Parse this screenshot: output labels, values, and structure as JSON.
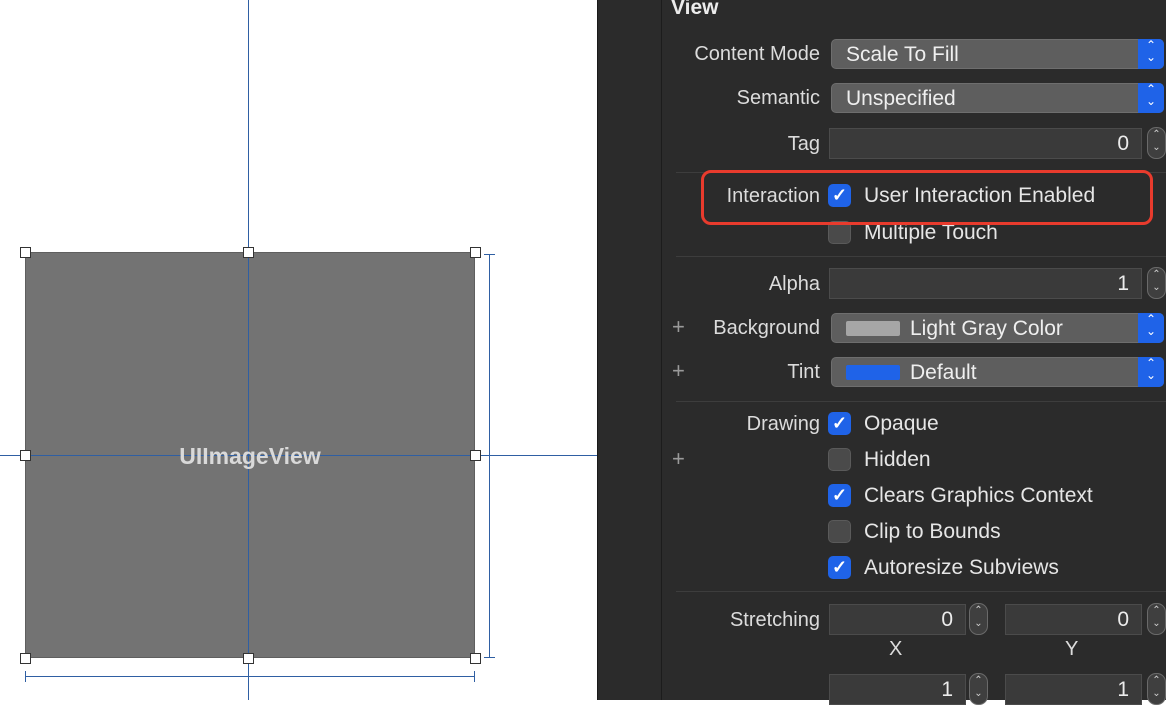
{
  "canvas": {
    "view_label": "UIImageView"
  },
  "inspector": {
    "section_title": "View",
    "content_mode": {
      "label": "Content Mode",
      "value": "Scale To Fill"
    },
    "semantic": {
      "label": "Semantic",
      "value": "Unspecified"
    },
    "tag": {
      "label": "Tag",
      "value": "0"
    },
    "interaction": {
      "label": "Interaction",
      "user_interaction_enabled": {
        "label": "User Interaction Enabled",
        "checked": true
      },
      "multiple_touch": {
        "label": "Multiple Touch",
        "checked": false
      }
    },
    "alpha": {
      "label": "Alpha",
      "value": "1"
    },
    "background": {
      "label": "Background",
      "value": "Light Gray Color",
      "swatch_color": "#a6a6a6"
    },
    "tint": {
      "label": "Tint",
      "value": "Default",
      "swatch_color": "#1f63e8"
    },
    "drawing": {
      "label": "Drawing",
      "options": [
        {
          "label": "Opaque",
          "checked": true
        },
        {
          "label": "Hidden",
          "checked": false
        },
        {
          "label": "Clears Graphics Context",
          "checked": true
        },
        {
          "label": "Clip to Bounds",
          "checked": false
        },
        {
          "label": "Autoresize Subviews",
          "checked": true
        }
      ]
    },
    "stretching": {
      "label": "Stretching",
      "x": "0",
      "y": "0",
      "x_label": "X",
      "y_label": "Y",
      "width": "1",
      "height": "1"
    }
  },
  "colors": {
    "accent": "#1f63e8",
    "highlight": "#e83b2d",
    "guide": "#2f5fa3"
  }
}
